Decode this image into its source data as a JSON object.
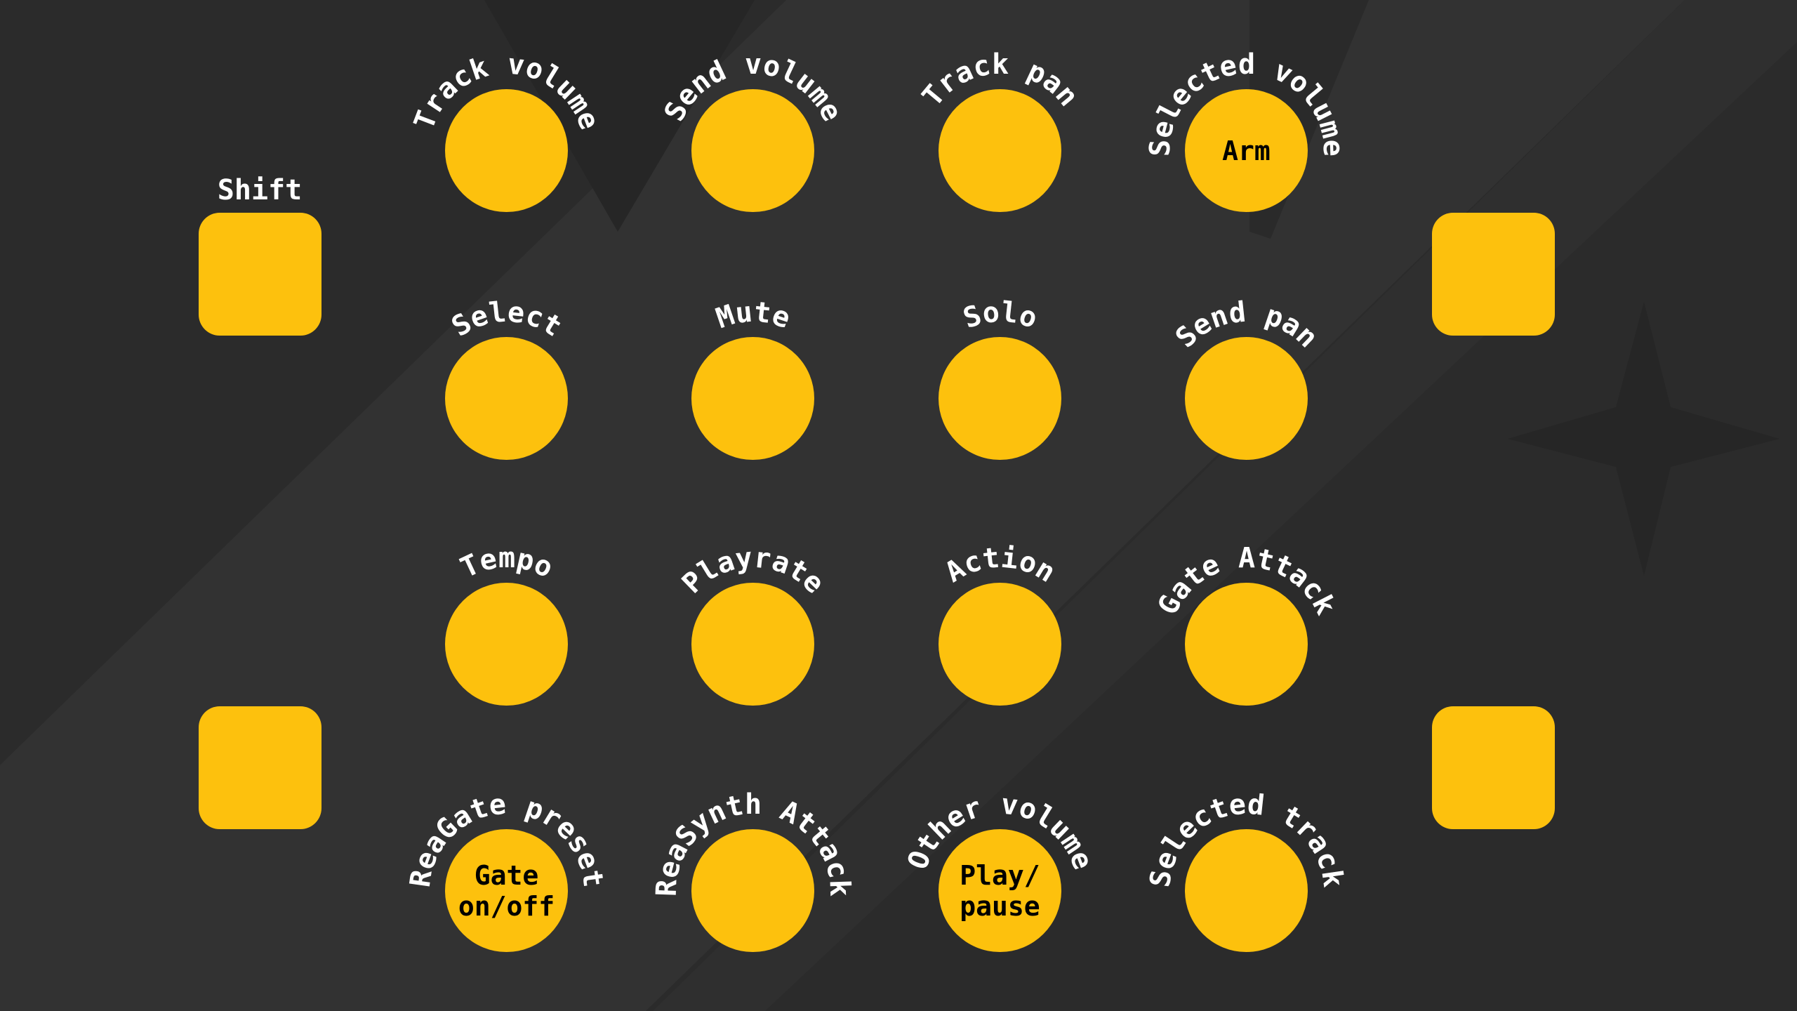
{
  "colors": {
    "background": "#2b2b2b",
    "stripe": "#333333",
    "shape_dark": "#232323",
    "button": "#fdc10d",
    "label": "#ffffff",
    "inner_text": "#000000"
  },
  "pads": {
    "top_left": {
      "label": "Shift"
    },
    "top_right": {
      "label": ""
    },
    "bottom_left": {
      "label": ""
    },
    "bottom_right": {
      "label": ""
    }
  },
  "knob_rows": [
    [
      {
        "id": "r1c1",
        "arc_label": "Track volume",
        "inner_label": ""
      },
      {
        "id": "r1c2",
        "arc_label": "Send  volume",
        "inner_label": ""
      },
      {
        "id": "r1c3",
        "arc_label": "Track pan",
        "inner_label": ""
      },
      {
        "id": "r1c4",
        "arc_label": "Selected volume",
        "inner_label": "Arm"
      }
    ],
    [
      {
        "id": "r2c1",
        "arc_label": "Select",
        "inner_label": ""
      },
      {
        "id": "r2c2",
        "arc_label": "Mute",
        "inner_label": ""
      },
      {
        "id": "r2c3",
        "arc_label": "Solo",
        "inner_label": ""
      },
      {
        "id": "r2c4",
        "arc_label": "Send pan",
        "inner_label": ""
      }
    ],
    [
      {
        "id": "r3c1",
        "arc_label": "Tempo",
        "inner_label": ""
      },
      {
        "id": "r3c2",
        "arc_label": "Playrate",
        "inner_label": ""
      },
      {
        "id": "r3c3",
        "arc_label": "Action",
        "inner_label": ""
      },
      {
        "id": "r3c4",
        "arc_label": "Gate Attack",
        "inner_label": ""
      }
    ],
    [
      {
        "id": "r4c1",
        "arc_label": "ReaGate preset",
        "inner_label": "Gate\non/off"
      },
      {
        "id": "r4c2",
        "arc_label": "ReaSynth Attack",
        "inner_label": ""
      },
      {
        "id": "r4c3",
        "arc_label": "Other volume",
        "inner_label": "Play/\npause"
      },
      {
        "id": "r4c4",
        "arc_label": "Selected track",
        "inner_label": ""
      }
    ]
  ]
}
